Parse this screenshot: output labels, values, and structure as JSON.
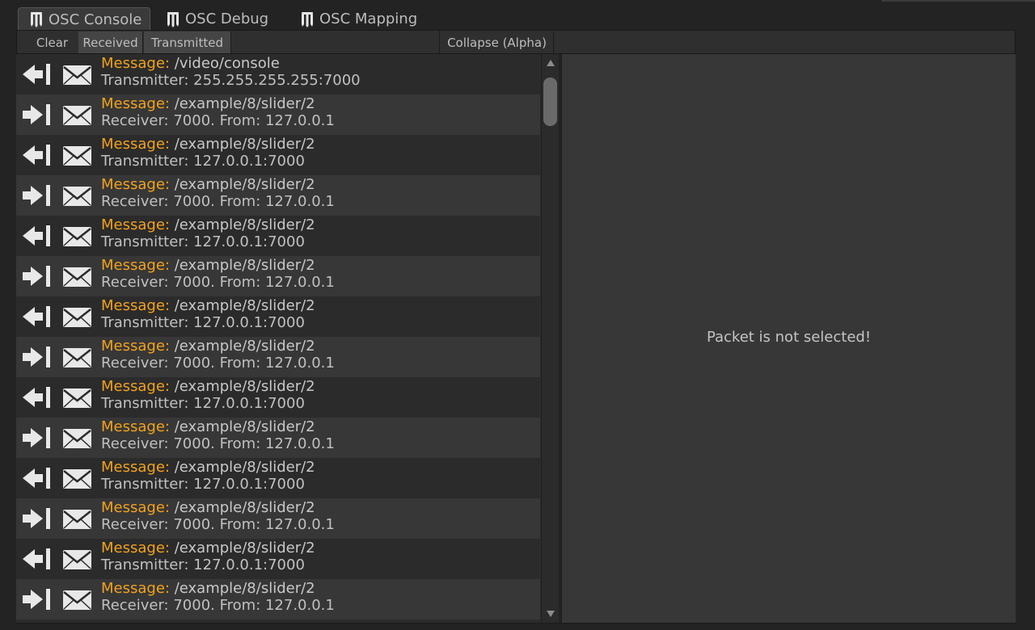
{
  "tabs": [
    {
      "label": "OSC Console",
      "active": true
    },
    {
      "label": "OSC Debug",
      "active": false
    },
    {
      "label": "OSC Mapping",
      "active": false
    }
  ],
  "toolbar": {
    "clear_label": "Clear",
    "received_label": "Received",
    "transmitted_label": "Transmitted",
    "collapse_label": "Collapse (Alpha)"
  },
  "message_label": "Message:",
  "packets": [
    {
      "direction": "transmit",
      "address": "/video/console",
      "detail": "Transmitter: 255.255.255.255:7000"
    },
    {
      "direction": "receive",
      "address": "/example/8/slider/2",
      "detail": "Receiver: 7000. From: 127.0.0.1"
    },
    {
      "direction": "transmit",
      "address": "/example/8/slider/2",
      "detail": "Transmitter: 127.0.0.1:7000"
    },
    {
      "direction": "receive",
      "address": "/example/8/slider/2",
      "detail": "Receiver: 7000. From: 127.0.0.1"
    },
    {
      "direction": "transmit",
      "address": "/example/8/slider/2",
      "detail": "Transmitter: 127.0.0.1:7000"
    },
    {
      "direction": "receive",
      "address": "/example/8/slider/2",
      "detail": "Receiver: 7000. From: 127.0.0.1"
    },
    {
      "direction": "transmit",
      "address": "/example/8/slider/2",
      "detail": "Transmitter: 127.0.0.1:7000"
    },
    {
      "direction": "receive",
      "address": "/example/8/slider/2",
      "detail": "Receiver: 7000. From: 127.0.0.1"
    },
    {
      "direction": "transmit",
      "address": "/example/8/slider/2",
      "detail": "Transmitter: 127.0.0.1:7000"
    },
    {
      "direction": "receive",
      "address": "/example/8/slider/2",
      "detail": "Receiver: 7000. From: 127.0.0.1"
    },
    {
      "direction": "transmit",
      "address": "/example/8/slider/2",
      "detail": "Transmitter: 127.0.0.1:7000"
    },
    {
      "direction": "receive",
      "address": "/example/8/slider/2",
      "detail": "Receiver: 7000. From: 127.0.0.1"
    },
    {
      "direction": "transmit",
      "address": "/example/8/slider/2",
      "detail": "Transmitter: 127.0.0.1:7000"
    },
    {
      "direction": "receive",
      "address": "/example/8/slider/2",
      "detail": "Receiver: 7000. From: 127.0.0.1"
    }
  ],
  "detail_panel": {
    "empty_text": "Packet is not selected!"
  },
  "icons": {
    "tab_icon": "osc-logo-icon",
    "transmit_icon": "arrow-left-bar-icon",
    "receive_icon": "arrow-right-bar-icon",
    "message_icon": "envelope-icon"
  },
  "colors": {
    "accent": "#f2a21c",
    "background": "#232323",
    "panel": "#373737"
  }
}
